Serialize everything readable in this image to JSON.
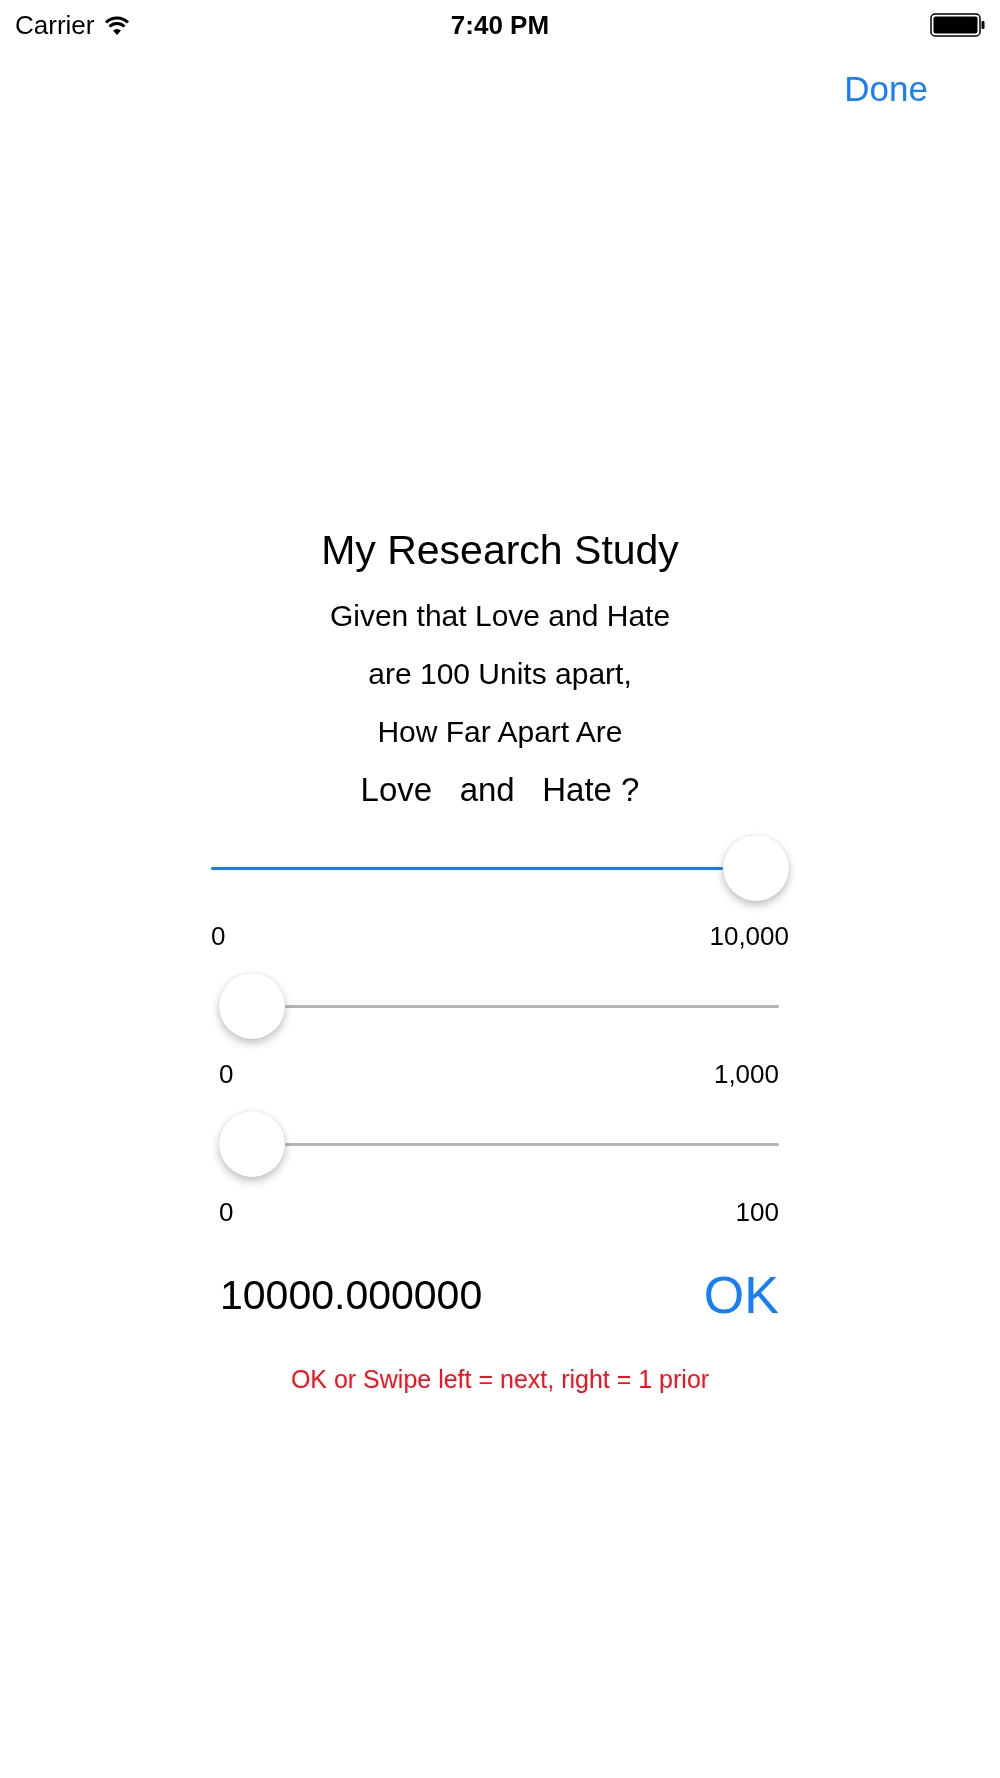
{
  "status_bar": {
    "carrier": "Carrier",
    "time": "7:40 PM"
  },
  "nav": {
    "done": "Done"
  },
  "title": "My Research Study",
  "question_lines": [
    "Given that Love and Hate",
    "are 100 Units apart,",
    "How Far Apart Are"
  ],
  "question_emphasis": "Love   and   Hate ?",
  "sliders": [
    {
      "level": 1,
      "min_label": "0",
      "max_label": "10,000"
    },
    {
      "level": 0,
      "min_label": "0",
      "max_label": "1,000"
    },
    {
      "level": 0,
      "min_label": "0",
      "max_label": "100"
    }
  ],
  "value": "10000.000000",
  "ok_button": "OK",
  "hint": "OK or Swipe left = next, right = 1 prior"
}
